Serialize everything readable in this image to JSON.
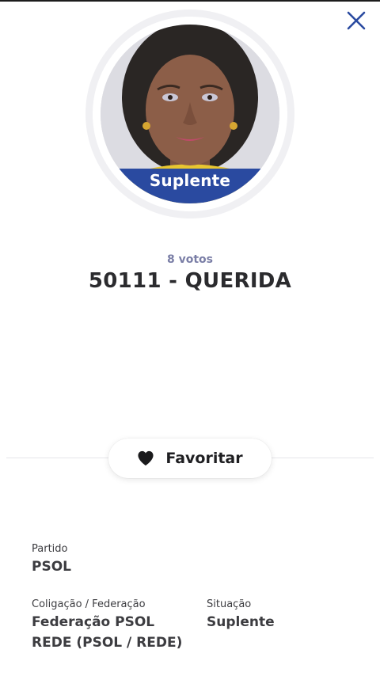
{
  "header": {
    "close_icon": "close-icon"
  },
  "candidate": {
    "status_badge": "Suplente",
    "votes": "8 votos",
    "name": "50111 - QUERIDA"
  },
  "actions": {
    "favorite_label": "Favoritar",
    "favorite_icon": "heart-icon"
  },
  "details": {
    "party_label": "Partido",
    "party_value": "PSOL",
    "coalition_label": "Coligação / Federação",
    "coalition_value_line1": "Federação PSOL",
    "coalition_value_line2": "REDE (PSOL / REDE)",
    "situation_label": "Situação",
    "situation_value": "Suplente"
  },
  "colors": {
    "accent": "#2a4aa0",
    "votes_text": "#7a7ea6",
    "close_icon": "#2a4aa0"
  }
}
